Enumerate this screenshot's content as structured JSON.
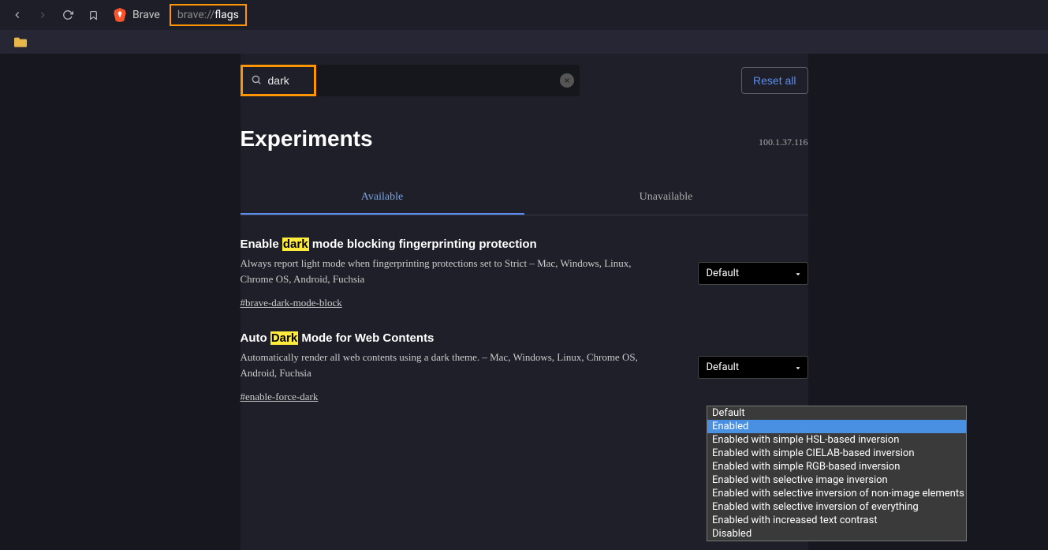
{
  "toolbar": {
    "brave_label": "Brave",
    "url_prefix": "brave://",
    "url_path": "flags"
  },
  "search": {
    "value": "dark",
    "reset_label": "Reset all"
  },
  "header": {
    "title": "Experiments",
    "version": "100.1.37.116"
  },
  "tabs": {
    "available": "Available",
    "unavailable": "Unavailable"
  },
  "flags": [
    {
      "title_pre": "Enable ",
      "title_hl": "dark",
      "title_post": " mode blocking fingerprinting protection",
      "desc": "Always report light mode when fingerprinting protections set to Strict – Mac, Windows, Linux, Chrome OS, Android, Fuchsia",
      "anchor": "#brave-dark-mode-block",
      "selected": "Default"
    },
    {
      "title_pre": "Auto ",
      "title_hl": "Dark",
      "title_post": " Mode for Web Contents",
      "desc": "Automatically render all web contents using a dark theme. – Mac, Windows, Linux, Chrome OS, Android, Fuchsia",
      "anchor": "#enable-force-dark",
      "selected": "Default"
    }
  ],
  "dropdown": {
    "options": [
      "Default",
      "Enabled",
      "Enabled with simple HSL-based inversion",
      "Enabled with simple CIELAB-based inversion",
      "Enabled with simple RGB-based inversion",
      "Enabled with selective image inversion",
      "Enabled with selective inversion of non-image elements",
      "Enabled with selective inversion of everything",
      "Enabled with increased text contrast",
      "Disabled"
    ],
    "selected_index": 1
  }
}
